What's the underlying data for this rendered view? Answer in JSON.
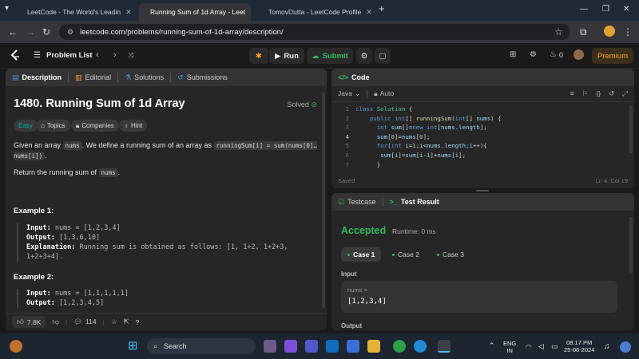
{
  "browser": {
    "tabs": [
      {
        "title": "LeetCode - The World's Leadin"
      },
      {
        "title": "Running Sum of 1d Array - Leet"
      },
      {
        "title": "TomovDutta - LeetCode Profile"
      }
    ],
    "new_tab": "+",
    "url": "leetcode.com/problems/running-sum-of-1d-array/description/"
  },
  "lc_nav": {
    "problem_list": "Problem List",
    "run": "Run",
    "submit": "Submit",
    "streak": "0",
    "premium": "Premium"
  },
  "description": {
    "tabs": [
      "Description",
      "Editorial",
      "Solutions",
      "Submissions"
    ],
    "title": "1480. Running Sum of 1d Array",
    "status": "Solved",
    "difficulty": "Easy",
    "chips": [
      "Topics",
      "Companies",
      "Hint"
    ],
    "para1_a": "Given an array ",
    "para1_code1": "nums",
    "para1_b": ". We define a running sum of an array as ",
    "para1_code2": "runningSum[i] = sum(nums[0]…nums[i])",
    "para1_c": ".",
    "para2_a": "Return the running sum of ",
    "para2_code": "nums",
    "para2_b": ".",
    "example1_title": "Example 1:",
    "example1": {
      "input_label": "Input:",
      "input": "nums = [1,2,3,4]",
      "output_label": "Output:",
      "output": "[1,3,6,10]",
      "expl_label": "Explanation:",
      "expl": "Running sum is obtained as follows: [1, 1+2, 1+2+3, 1+2+3+4]."
    },
    "example2_title": "Example 2:",
    "example2": {
      "input_label": "Input:",
      "input": "nums = [1,1,1,1,1]",
      "output_label": "Output:",
      "output": "[1,2,3,4,5]"
    },
    "likes": "7.8K",
    "comments": "114"
  },
  "code": {
    "tab": "Code",
    "language": "Java",
    "mode": "Auto",
    "lines": [
      {
        "n": "1",
        "text": "class Solution {"
      },
      {
        "n": "2",
        "text": "    public int[] runningSum(int[] nums) {"
      },
      {
        "n": "3",
        "text": "      int sum[]=new int[nums.length];"
      },
      {
        "n": "4",
        "text": "      sum[0]=nums[0];"
      },
      {
        "n": "5",
        "text": "      for(int i=1;i<nums.length;i++){"
      },
      {
        "n": "6",
        "text": "       sum[i]=sum[i-1]+nums[i];"
      },
      {
        "n": "7",
        "text": "      }"
      }
    ],
    "saved": "Saved",
    "cursor": "Ln 4, Col 19"
  },
  "testcase": {
    "tabs": [
      "Testcase",
      "Test Result"
    ],
    "accepted": "Accepted",
    "runtime": "Runtime: 0 ms",
    "cases": [
      "Case 1",
      "Case 2",
      "Case 3"
    ],
    "input_label": "Input",
    "nums_label": "nums =",
    "nums_value": "[1,2,3,4]",
    "output_label": "Output"
  },
  "taskbar": {
    "search": "Search",
    "lang_top": "ENG",
    "lang_bottom": "IN",
    "time": "08:17 PM",
    "date": "25-06-2024"
  },
  "colors": {
    "accent": "#ffa116",
    "accepted": "#2cbb5d",
    "submit": "#2cbb5d"
  }
}
